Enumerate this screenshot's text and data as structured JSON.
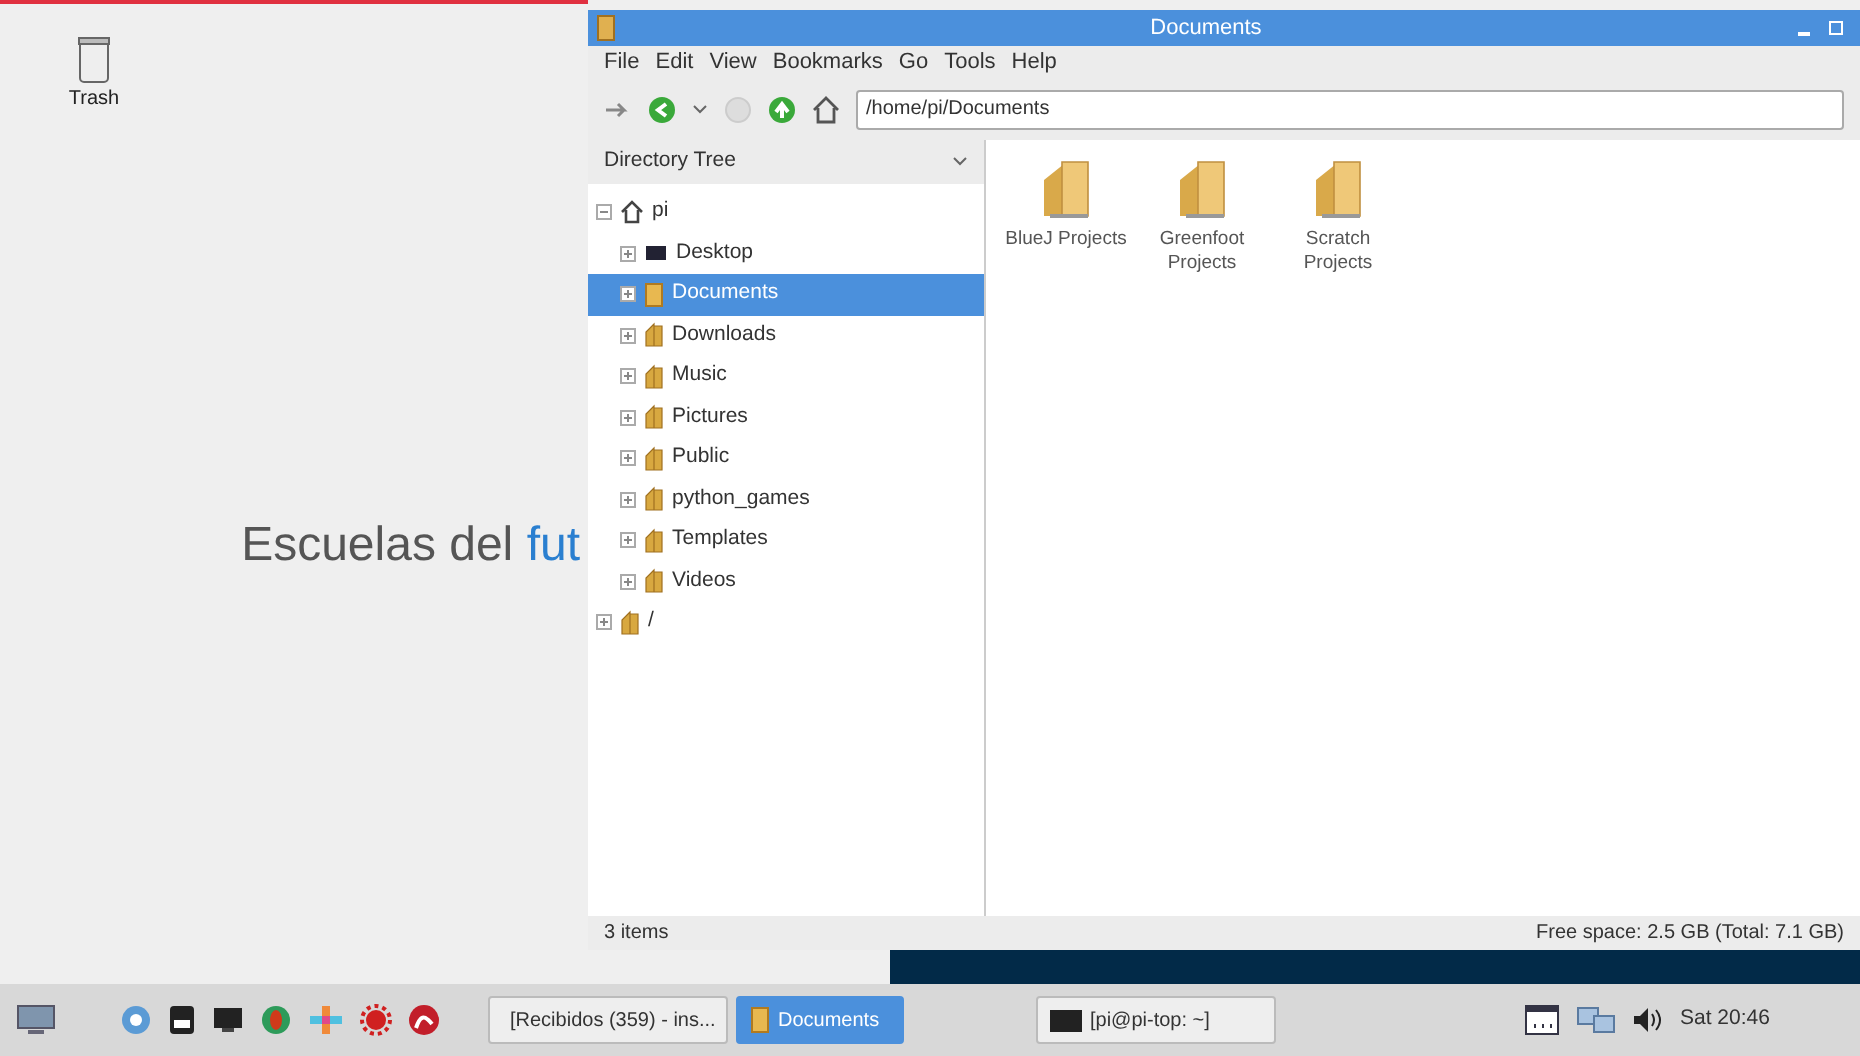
{
  "desktop": {
    "icons": [
      {
        "label": "Trash"
      }
    ],
    "wallpaper_text": {
      "text": "Escuelas del",
      "accent": "fut"
    }
  },
  "window": {
    "title": "Documents",
    "menu": [
      "File",
      "Edit",
      "View",
      "Bookmarks",
      "Go",
      "Tools",
      "Help"
    ],
    "path": "/home/pi/Documents",
    "sidebar": {
      "title": "Directory Tree",
      "tree": [
        {
          "label": "pi",
          "kind": "home",
          "expanded": true,
          "selected": false,
          "children": [
            {
              "label": "Desktop",
              "kind": "desktop",
              "expanded": false,
              "selected": false
            },
            {
              "label": "Documents",
              "kind": "documents",
              "expanded": false,
              "selected": true
            },
            {
              "label": "Downloads",
              "kind": "folder",
              "expanded": false,
              "selected": false
            },
            {
              "label": "Music",
              "kind": "folder",
              "expanded": false,
              "selected": false
            },
            {
              "label": "Pictures",
              "kind": "folder",
              "expanded": false,
              "selected": false
            },
            {
              "label": "Public",
              "kind": "folder",
              "expanded": false,
              "selected": false
            },
            {
              "label": "python_games",
              "kind": "folder",
              "expanded": false,
              "selected": false
            },
            {
              "label": "Templates",
              "kind": "folder",
              "expanded": false,
              "selected": false
            },
            {
              "label": "Videos",
              "kind": "folder",
              "expanded": false,
              "selected": false
            }
          ]
        },
        {
          "label": "/",
          "kind": "folder",
          "expanded": false,
          "selected": false
        }
      ]
    },
    "files": [
      {
        "label": "BlueJ Projects"
      },
      {
        "label": "Greenfoot Projects"
      },
      {
        "label": "Scratch Projects"
      }
    ],
    "status_bar": {
      "left": "3 items",
      "right": "Free space: 2.5 GB (Total: 7.1 GB)"
    }
  },
  "taskbar": {
    "tasks": [
      {
        "label": "[Recibidos (359) - ins...",
        "kind": "browser",
        "selected": false
      },
      {
        "label": "Documents",
        "kind": "folder",
        "selected": true
      },
      {
        "label": "[pi@pi-top: ~]",
        "kind": "terminal",
        "selected": false
      }
    ],
    "clock": "Sat 20:46"
  }
}
